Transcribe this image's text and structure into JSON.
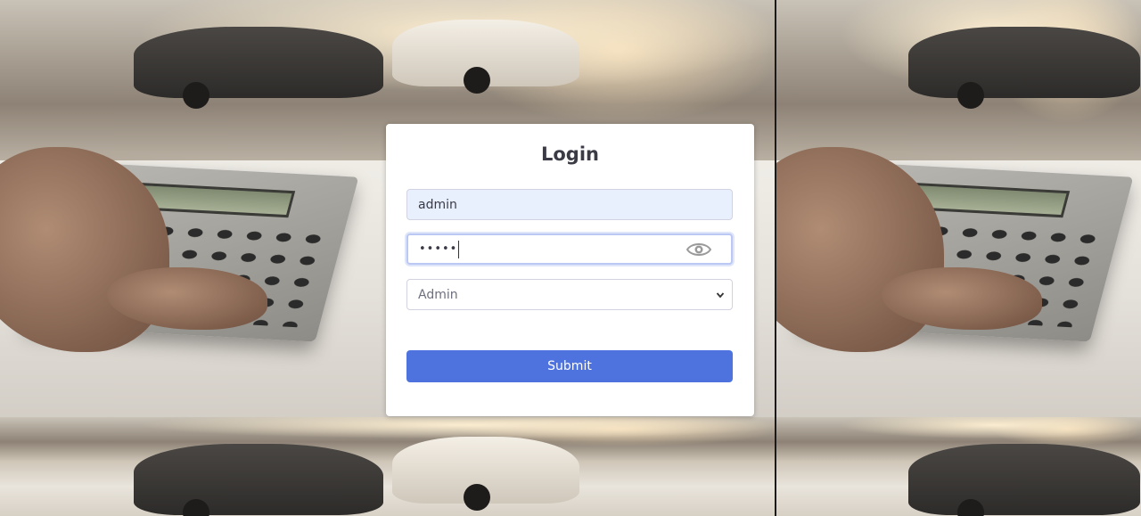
{
  "login": {
    "title": "Login",
    "username_value": "admin",
    "password_masked": "•••••",
    "role_selected": "Admin",
    "submit_label": "Submit"
  },
  "icons": {
    "password_toggle": "eye-icon",
    "select_arrow": "chevron-down-icon"
  },
  "colors": {
    "primary": "#4e73df",
    "autofill_bg": "#e8f0fe",
    "title_text": "#3a3b45"
  }
}
